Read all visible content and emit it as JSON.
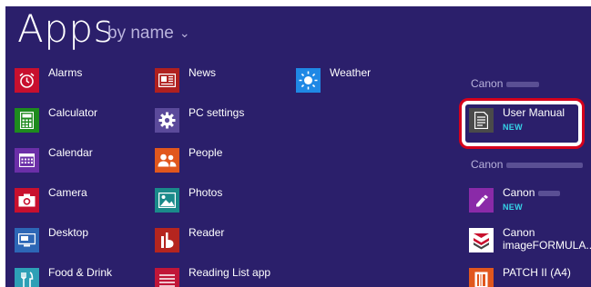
{
  "header": {
    "title": "Apps",
    "sort_label": "by name"
  },
  "column1": [
    {
      "label": "Alarms",
      "color": "#c8102e",
      "icon": "alarm-clock-icon"
    },
    {
      "label": "Calculator",
      "color": "#1e8b1e",
      "icon": "calculator-icon"
    },
    {
      "label": "Calendar",
      "color": "#6b2fa8",
      "icon": "calendar-icon"
    },
    {
      "label": "Camera",
      "color": "#c8102e",
      "icon": "camera-icon"
    },
    {
      "label": "Desktop",
      "color": "#2d67b6",
      "icon": "desktop-icon"
    },
    {
      "label": "Food & Drink",
      "color": "#2da0b6",
      "icon": "food-drink-icon"
    }
  ],
  "column2": [
    {
      "label": "News",
      "color": "#b0201f",
      "icon": "news-icon"
    },
    {
      "label": "PC settings",
      "color": "#5b4a9b",
      "icon": "gear-icon"
    },
    {
      "label": "People",
      "color": "#e1571d",
      "icon": "people-icon"
    },
    {
      "label": "Photos",
      "color": "#1a8a8a",
      "icon": "photos-icon"
    },
    {
      "label": "Reader",
      "color": "#b5251f",
      "icon": "reader-icon"
    },
    {
      "label": "Reading List app",
      "color": "#c01638",
      "icon": "reading-list-icon"
    }
  ],
  "column3": [
    {
      "label": "Weather",
      "color": "#1f88e5",
      "icon": "sun-icon"
    }
  ],
  "groups": [
    {
      "header": "Canon"
    },
    {
      "header": "Canon"
    }
  ],
  "canon_apps": [
    {
      "label": "User Manual",
      "badge": "NEW",
      "color": "#4a4a4a",
      "icon": "document-icon"
    },
    {
      "label": "Canon",
      "badge": "NEW",
      "color": "#8a2aa8",
      "icon": "canon-tool-icon"
    },
    {
      "label": "Canon",
      "line2": "imageFORMULA...",
      "color": "#ffffff",
      "icon": "imageformula-icon"
    },
    {
      "label": "PATCH II (A4)",
      "color": "#e1571d",
      "icon": "patch-sheet-icon"
    }
  ],
  "colors": {
    "background": "#2b1f6b",
    "highlight": "#d6001c",
    "new_badge": "#35d4e8"
  }
}
